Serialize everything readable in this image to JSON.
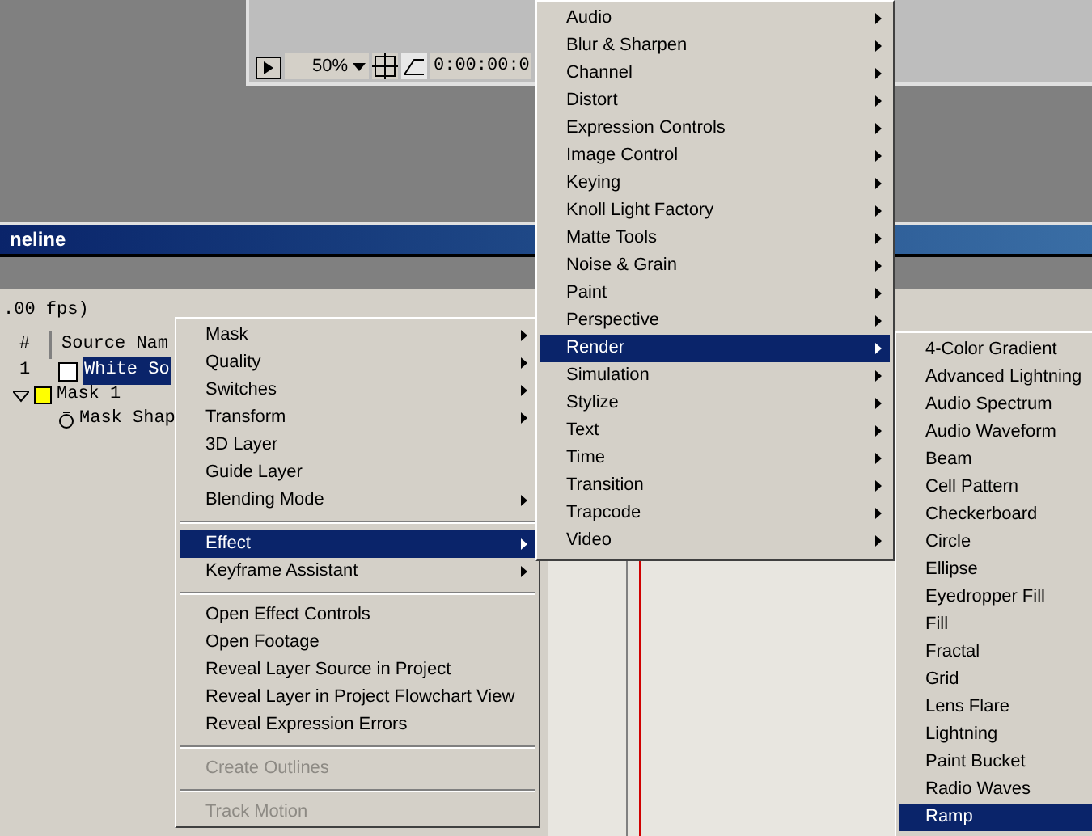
{
  "viewer": {
    "zoom": "50%",
    "timecode": "0:00:00:0"
  },
  "timeline": {
    "title": "neline",
    "fps": ".00 fps)",
    "columns": [
      "#",
      "Source Nam"
    ],
    "layers": [
      {
        "kind": "layer",
        "number": "1",
        "name": "White So",
        "selected": true
      },
      {
        "kind": "mask",
        "name": "Mask 1",
        "color": "#ffff00",
        "expanded": true
      },
      {
        "kind": "property",
        "name": "Mask Shap"
      }
    ]
  },
  "context_menu": {
    "items": [
      {
        "label": "Mask",
        "submenu": true,
        "disabled": false,
        "selected": false
      },
      {
        "label": "Quality",
        "submenu": true,
        "disabled": false,
        "selected": false
      },
      {
        "label": "Switches",
        "submenu": true,
        "disabled": false,
        "selected": false
      },
      {
        "label": "Transform",
        "submenu": true,
        "disabled": false,
        "selected": false
      },
      {
        "label": "3D Layer",
        "submenu": false,
        "disabled": false,
        "selected": false
      },
      {
        "label": "Guide Layer",
        "submenu": false,
        "disabled": false,
        "selected": false
      },
      {
        "label": "Blending Mode",
        "submenu": true,
        "disabled": false,
        "selected": false
      },
      {
        "kind": "separator"
      },
      {
        "label": "Effect",
        "submenu": true,
        "disabled": false,
        "selected": true
      },
      {
        "label": "Keyframe Assistant",
        "submenu": true,
        "disabled": false,
        "selected": false
      },
      {
        "kind": "separator"
      },
      {
        "label": "Open Effect Controls",
        "submenu": false,
        "disabled": false,
        "selected": false
      },
      {
        "label": "Open Footage",
        "submenu": false,
        "disabled": false,
        "selected": false
      },
      {
        "label": "Reveal Layer Source in Project",
        "submenu": false,
        "disabled": false,
        "selected": false
      },
      {
        "label": "Reveal Layer in Project Flowchart View",
        "submenu": false,
        "disabled": false,
        "selected": false
      },
      {
        "label": "Reveal Expression Errors",
        "submenu": false,
        "disabled": false,
        "selected": false
      },
      {
        "kind": "separator"
      },
      {
        "label": "Create Outlines",
        "submenu": false,
        "disabled": true,
        "selected": false
      },
      {
        "kind": "separator"
      },
      {
        "label": "Track Motion",
        "submenu": false,
        "disabled": true,
        "selected": false
      }
    ]
  },
  "effect_menu": {
    "items": [
      {
        "label": "Audio",
        "selected": false
      },
      {
        "label": "Blur & Sharpen",
        "selected": false
      },
      {
        "label": "Channel",
        "selected": false
      },
      {
        "label": "Distort",
        "selected": false
      },
      {
        "label": "Expression Controls",
        "selected": false
      },
      {
        "label": "Image Control",
        "selected": false
      },
      {
        "label": "Keying",
        "selected": false
      },
      {
        "label": "Knoll Light Factory",
        "selected": false
      },
      {
        "label": "Matte Tools",
        "selected": false
      },
      {
        "label": "Noise & Grain",
        "selected": false
      },
      {
        "label": "Paint",
        "selected": false
      },
      {
        "label": "Perspective",
        "selected": false
      },
      {
        "label": "Render",
        "selected": true
      },
      {
        "label": "Simulation",
        "selected": false
      },
      {
        "label": "Stylize",
        "selected": false
      },
      {
        "label": "Text",
        "selected": false
      },
      {
        "label": "Time",
        "selected": false
      },
      {
        "label": "Transition",
        "selected": false
      },
      {
        "label": "Trapcode",
        "selected": false
      },
      {
        "label": "Video",
        "selected": false
      }
    ]
  },
  "render_menu": {
    "items": [
      {
        "label": "4-Color Gradient",
        "selected": false
      },
      {
        "label": "Advanced Lightning",
        "selected": false
      },
      {
        "label": "Audio Spectrum",
        "selected": false
      },
      {
        "label": "Audio Waveform",
        "selected": false
      },
      {
        "label": "Beam",
        "selected": false
      },
      {
        "label": "Cell Pattern",
        "selected": false
      },
      {
        "label": "Checkerboard",
        "selected": false
      },
      {
        "label": "Circle",
        "selected": false
      },
      {
        "label": "Ellipse",
        "selected": false
      },
      {
        "label": "Eyedropper Fill",
        "selected": false
      },
      {
        "label": "Fill",
        "selected": false
      },
      {
        "label": "Fractal",
        "selected": false
      },
      {
        "label": "Grid",
        "selected": false
      },
      {
        "label": "Lens Flare",
        "selected": false
      },
      {
        "label": "Lightning",
        "selected": false
      },
      {
        "label": "Paint Bucket",
        "selected": false
      },
      {
        "label": "Radio Waves",
        "selected": false
      },
      {
        "label": "Ramp",
        "selected": true
      }
    ]
  }
}
